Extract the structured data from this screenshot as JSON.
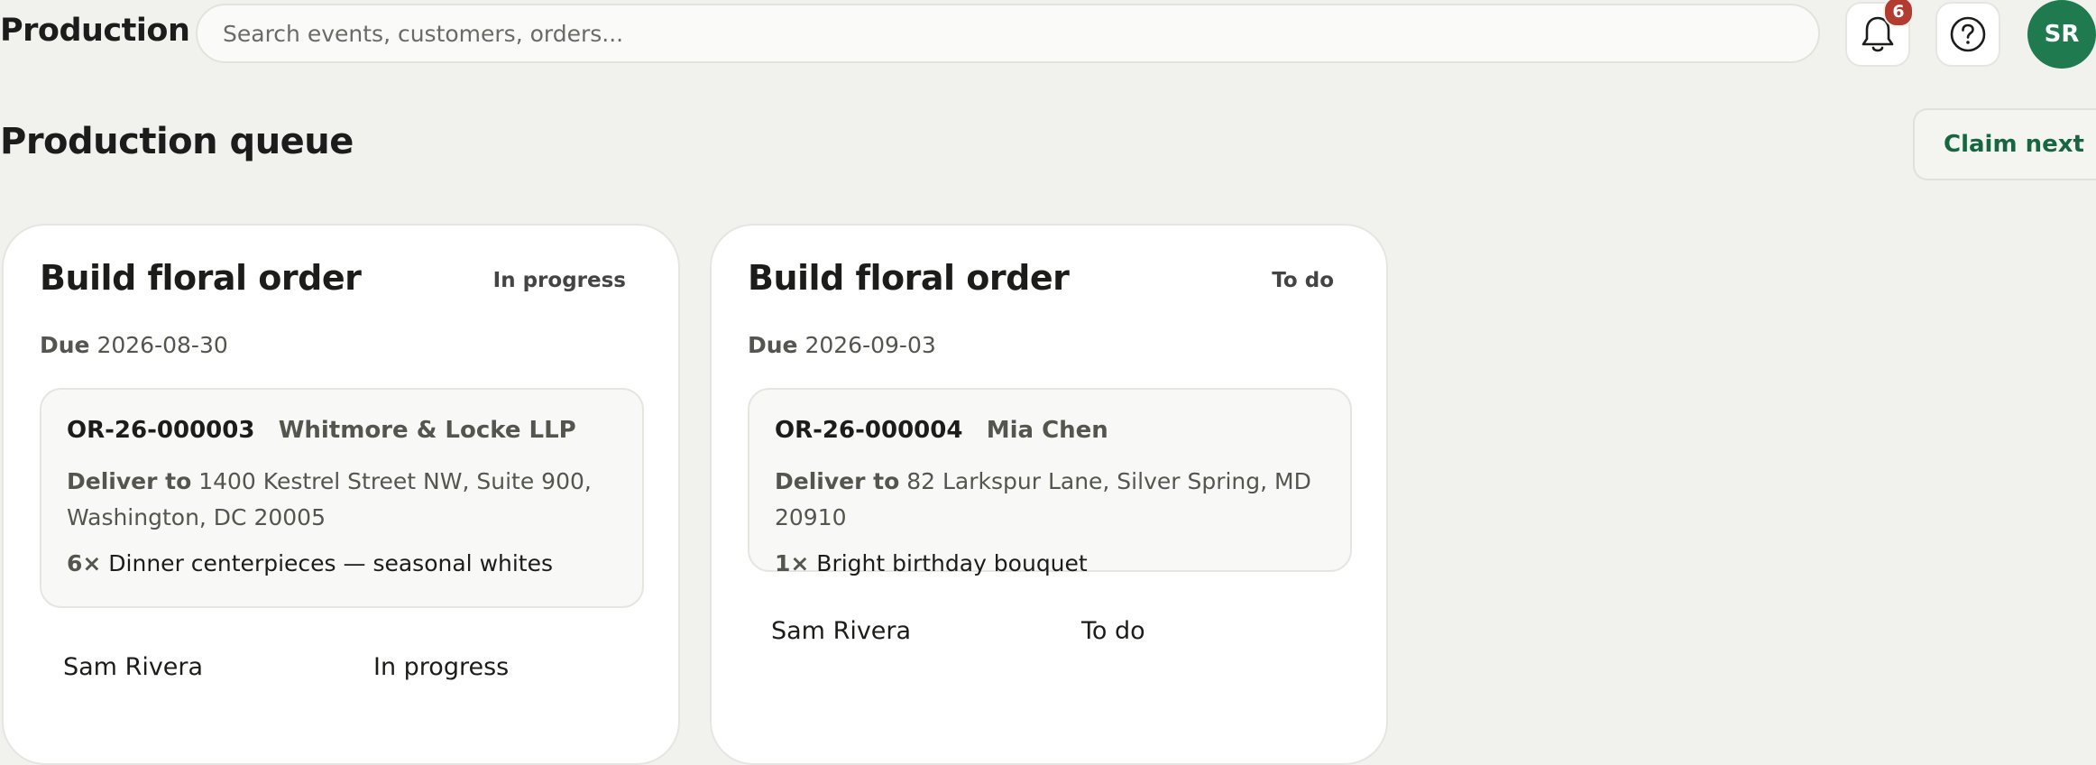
{
  "header": {
    "app_title": "Production",
    "search": {
      "placeholder": "Search events, customers, orders...",
      "value": ""
    },
    "notifications": {
      "icon": "bell-icon",
      "count": "6"
    },
    "help": {
      "icon": "help-circle-icon"
    },
    "avatar": {
      "initials": "SR",
      "color": "#1f7a4f"
    }
  },
  "page": {
    "title": "Production queue",
    "claim_next_label": "Claim next"
  },
  "cards": [
    {
      "title": "Build floral order",
      "status": "In progress",
      "due_label": "Due",
      "due_date": "2026-08-30",
      "order_id": "OR-26-000003",
      "customer": "Whitmore & Locke LLP",
      "deliver_label": "Deliver to",
      "address": "1400 Kestrel Street NW, Suite 900, Washington, DC 20005",
      "item_qty": "6×",
      "item_name": "Dinner centerpieces — seasonal whites",
      "assignee": "Sam Rivera",
      "footer_status": "In progress"
    },
    {
      "title": "Build floral order",
      "status": "To do",
      "due_label": "Due",
      "due_date": "2026-09-03",
      "order_id": "OR-26-000004",
      "customer": "Mia Chen",
      "deliver_label": "Deliver to",
      "address": "82 Larkspur Lane, Silver Spring, MD 20910",
      "item_qty": "1×",
      "item_name": "Bright birthday bouquet",
      "assignee": "Sam Rivera",
      "footer_status": "To do"
    }
  ],
  "colors": {
    "background": "#f1f1ee",
    "accent_green": "#17663f",
    "badge_red": "#b23b32"
  }
}
